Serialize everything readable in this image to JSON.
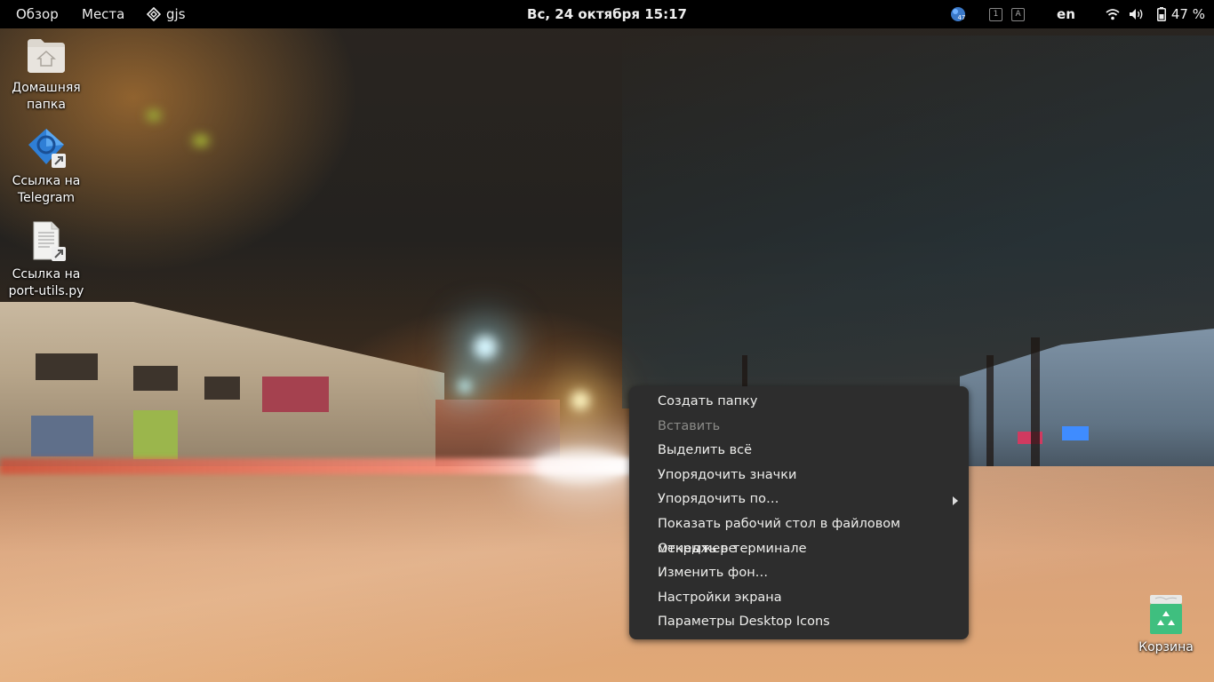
{
  "topbar": {
    "activities": "Обзор",
    "places": "Места",
    "app_name": "gjs",
    "app_icon": "gjs-diamond-icon",
    "clock": "Вс, 24 октября  15:17",
    "tray": {
      "update_badge": "47",
      "workspace_1": "1",
      "workspace_2": "A",
      "language": "en",
      "battery": "47 %"
    }
  },
  "desktop": {
    "icons": [
      {
        "label_line1": "Домашняя",
        "label_line2": "папка",
        "icon": "home-folder-icon"
      },
      {
        "label_line1": "Ссылка на",
        "label_line2": "Telegram",
        "icon": "telegram-link-icon"
      },
      {
        "label_line1": "Ссылка на",
        "label_line2": "port-utils.py",
        "icon": "text-file-link-icon"
      }
    ],
    "trash": {
      "label": "Корзина",
      "icon": "trash-icon"
    }
  },
  "context_menu": {
    "items": [
      {
        "label": "Создать папку",
        "enabled": true
      },
      {
        "label": "Вставить",
        "enabled": false
      },
      {
        "label": "Выделить всё",
        "enabled": true
      },
      {
        "label": "Упорядочить значки",
        "enabled": true
      },
      {
        "label": "Упорядочить по…",
        "enabled": true,
        "submenu": true
      },
      {
        "label": "Показать рабочий стол в файловом менеджере",
        "enabled": true
      },
      {
        "label": "Открыть в терминале",
        "enabled": true
      },
      {
        "label": "Изменить фон…",
        "enabled": true
      },
      {
        "label": "Настройки экрана",
        "enabled": true
      },
      {
        "label": "Параметры Desktop Icons",
        "enabled": true
      }
    ]
  },
  "colors": {
    "topbar_bg": "#000000",
    "menu_bg": "#2d2d2d",
    "menu_text": "#eeeeec",
    "menu_disabled_text": "#8b8b88",
    "trash_green": "#3fbf7f"
  }
}
